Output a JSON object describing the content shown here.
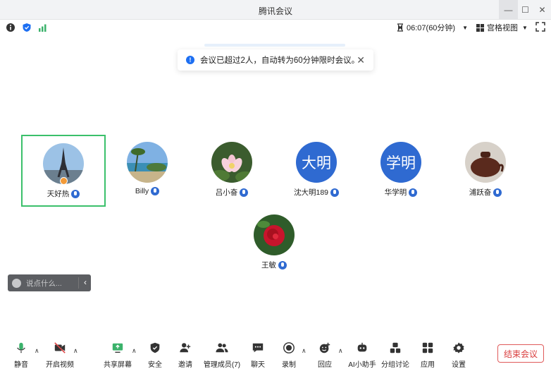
{
  "window": {
    "title": "腾讯会议",
    "controls": {
      "minimize": "—",
      "maximize": "☐",
      "close": "✕"
    }
  },
  "status": {
    "timer": "06:07(60分钟)",
    "view_label": "宫格视图",
    "signal_color": "#3bb26b",
    "shield_color": "#1d6ff2"
  },
  "notice": {
    "message": "会议已超过2人，自动转为60分钟限时会议。",
    "info_icon": "info-icon",
    "close_glyph": "✕"
  },
  "participants": [
    {
      "name": "天好热",
      "avatar": "photo-tower",
      "host": true,
      "active": true
    },
    {
      "name": "Billy",
      "avatar": "photo-beach"
    },
    {
      "name": "吕小奋",
      "avatar": "photo-lotus"
    },
    {
      "name": "沈大明189",
      "avatar_text": "大明"
    },
    {
      "name": "华学明",
      "avatar_text": "学明"
    },
    {
      "name": "浦跃奋",
      "avatar": "photo-teapot"
    },
    {
      "name": "王敏",
      "avatar": "photo-rose"
    }
  ],
  "chat": {
    "placeholder": "说点什么...",
    "collapse_glyph": "‹"
  },
  "toolbar": {
    "mute": "静音",
    "video": "开启视频",
    "share": "共享屏幕",
    "security": "安全",
    "invite": "邀请",
    "members": "管理成员(7)",
    "chat": "聊天",
    "record": "录制",
    "reactions": "回应",
    "ai": "AI小助手",
    "breakout": "分组讨论",
    "apps": "应用",
    "settings": "设置",
    "end": "结束会议"
  },
  "colors": {
    "accent": "#2f6ad1",
    "end": "#d93c3c",
    "active_border": "#3bc06b"
  }
}
